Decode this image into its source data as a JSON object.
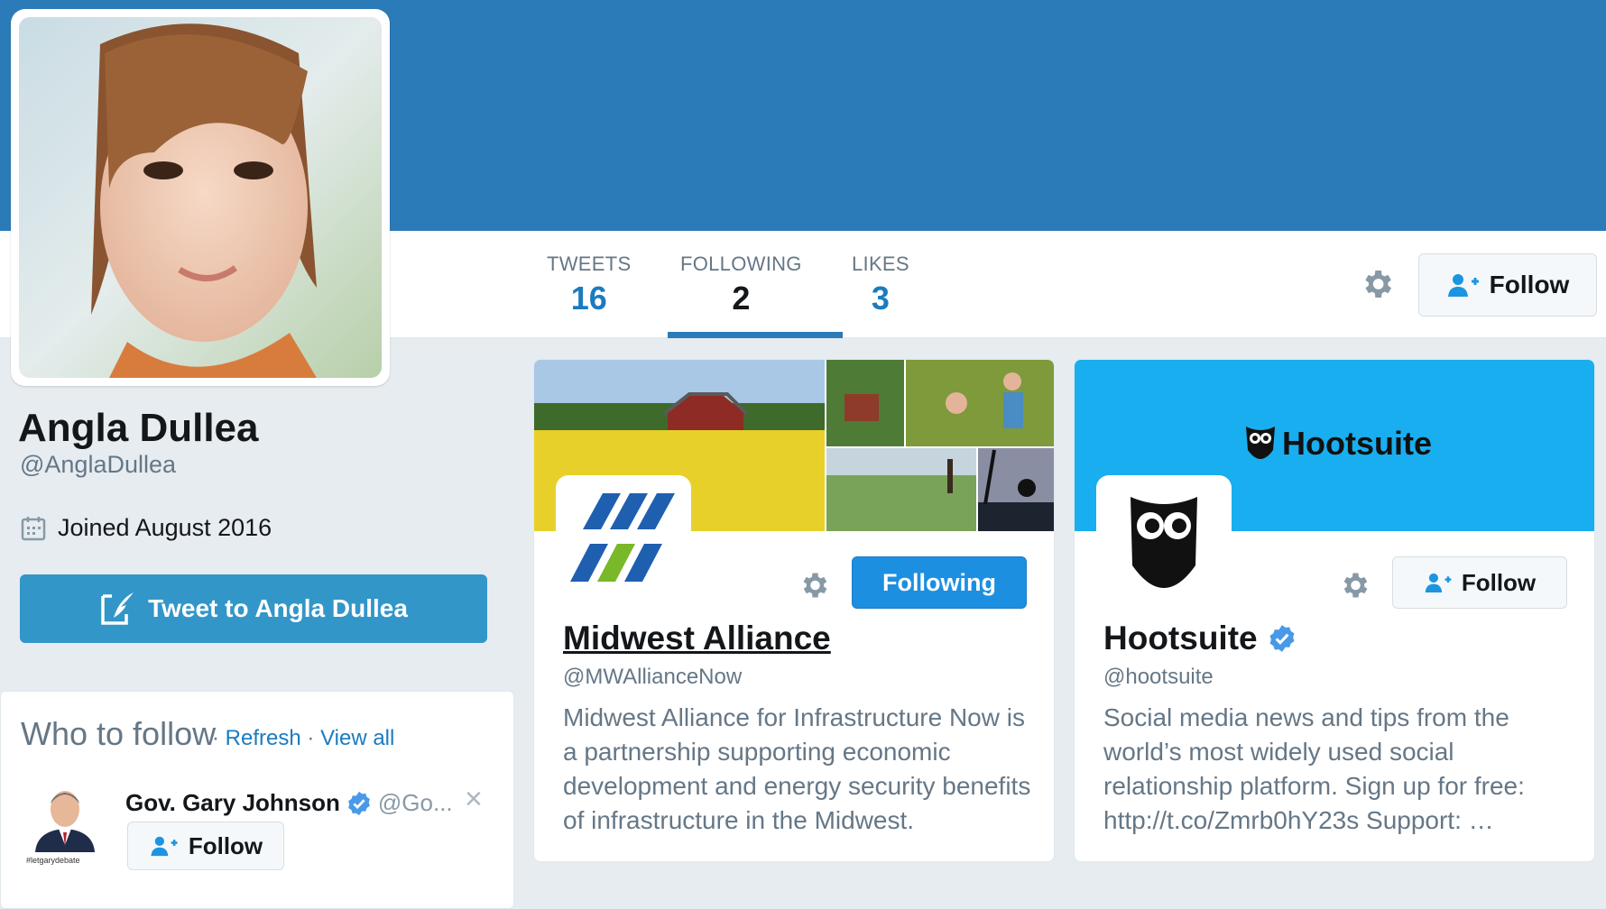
{
  "profile": {
    "name": "Angla Dullea",
    "handle": "@AnglaDullea",
    "joined": "Joined August 2016",
    "tweet_to": "Tweet to Angla Dullea"
  },
  "stats": [
    {
      "label": "TWEETS",
      "value": "16"
    },
    {
      "label": "FOLLOWING",
      "value": "2"
    },
    {
      "label": "LIKES",
      "value": "3"
    }
  ],
  "nav": {
    "follow_label": "Follow"
  },
  "who_to_follow": {
    "title": "Who to follow",
    "sep1": "·",
    "refresh": "Refresh",
    "sep2": "·",
    "view_all": "View all",
    "suggestion": {
      "name": "Gov. Gary Johnson",
      "handle": "@Go...",
      "follow_label": "Follow",
      "avatar_caption": "#letgarydebate",
      "close": "×"
    }
  },
  "cards": [
    {
      "name": "Midwest Alliance",
      "handle": "@MWAllianceNow",
      "bio": "Midwest Alliance for Infrastructure Now is a partnership supporting economic development and energy security benefits of infrastructure in the Midwest.",
      "button_label": "Following"
    },
    {
      "name": "Hootsuite",
      "handle": "@hootsuite",
      "bio": "Social media news and tips from the world’s most widely used social relationship platform. Sign up for free: http://t.co/Zmrb0hY23s Support: …",
      "button_label": "Follow",
      "banner_text": "Hootsuite",
      "verified": true
    }
  ],
  "colors": {
    "banner": "#2b7bb9",
    "link": "#1b7bc0",
    "tweet_button": "#3396c8",
    "following_button": "#1d8fe0",
    "hootsuite_banner": "#19aeef"
  }
}
